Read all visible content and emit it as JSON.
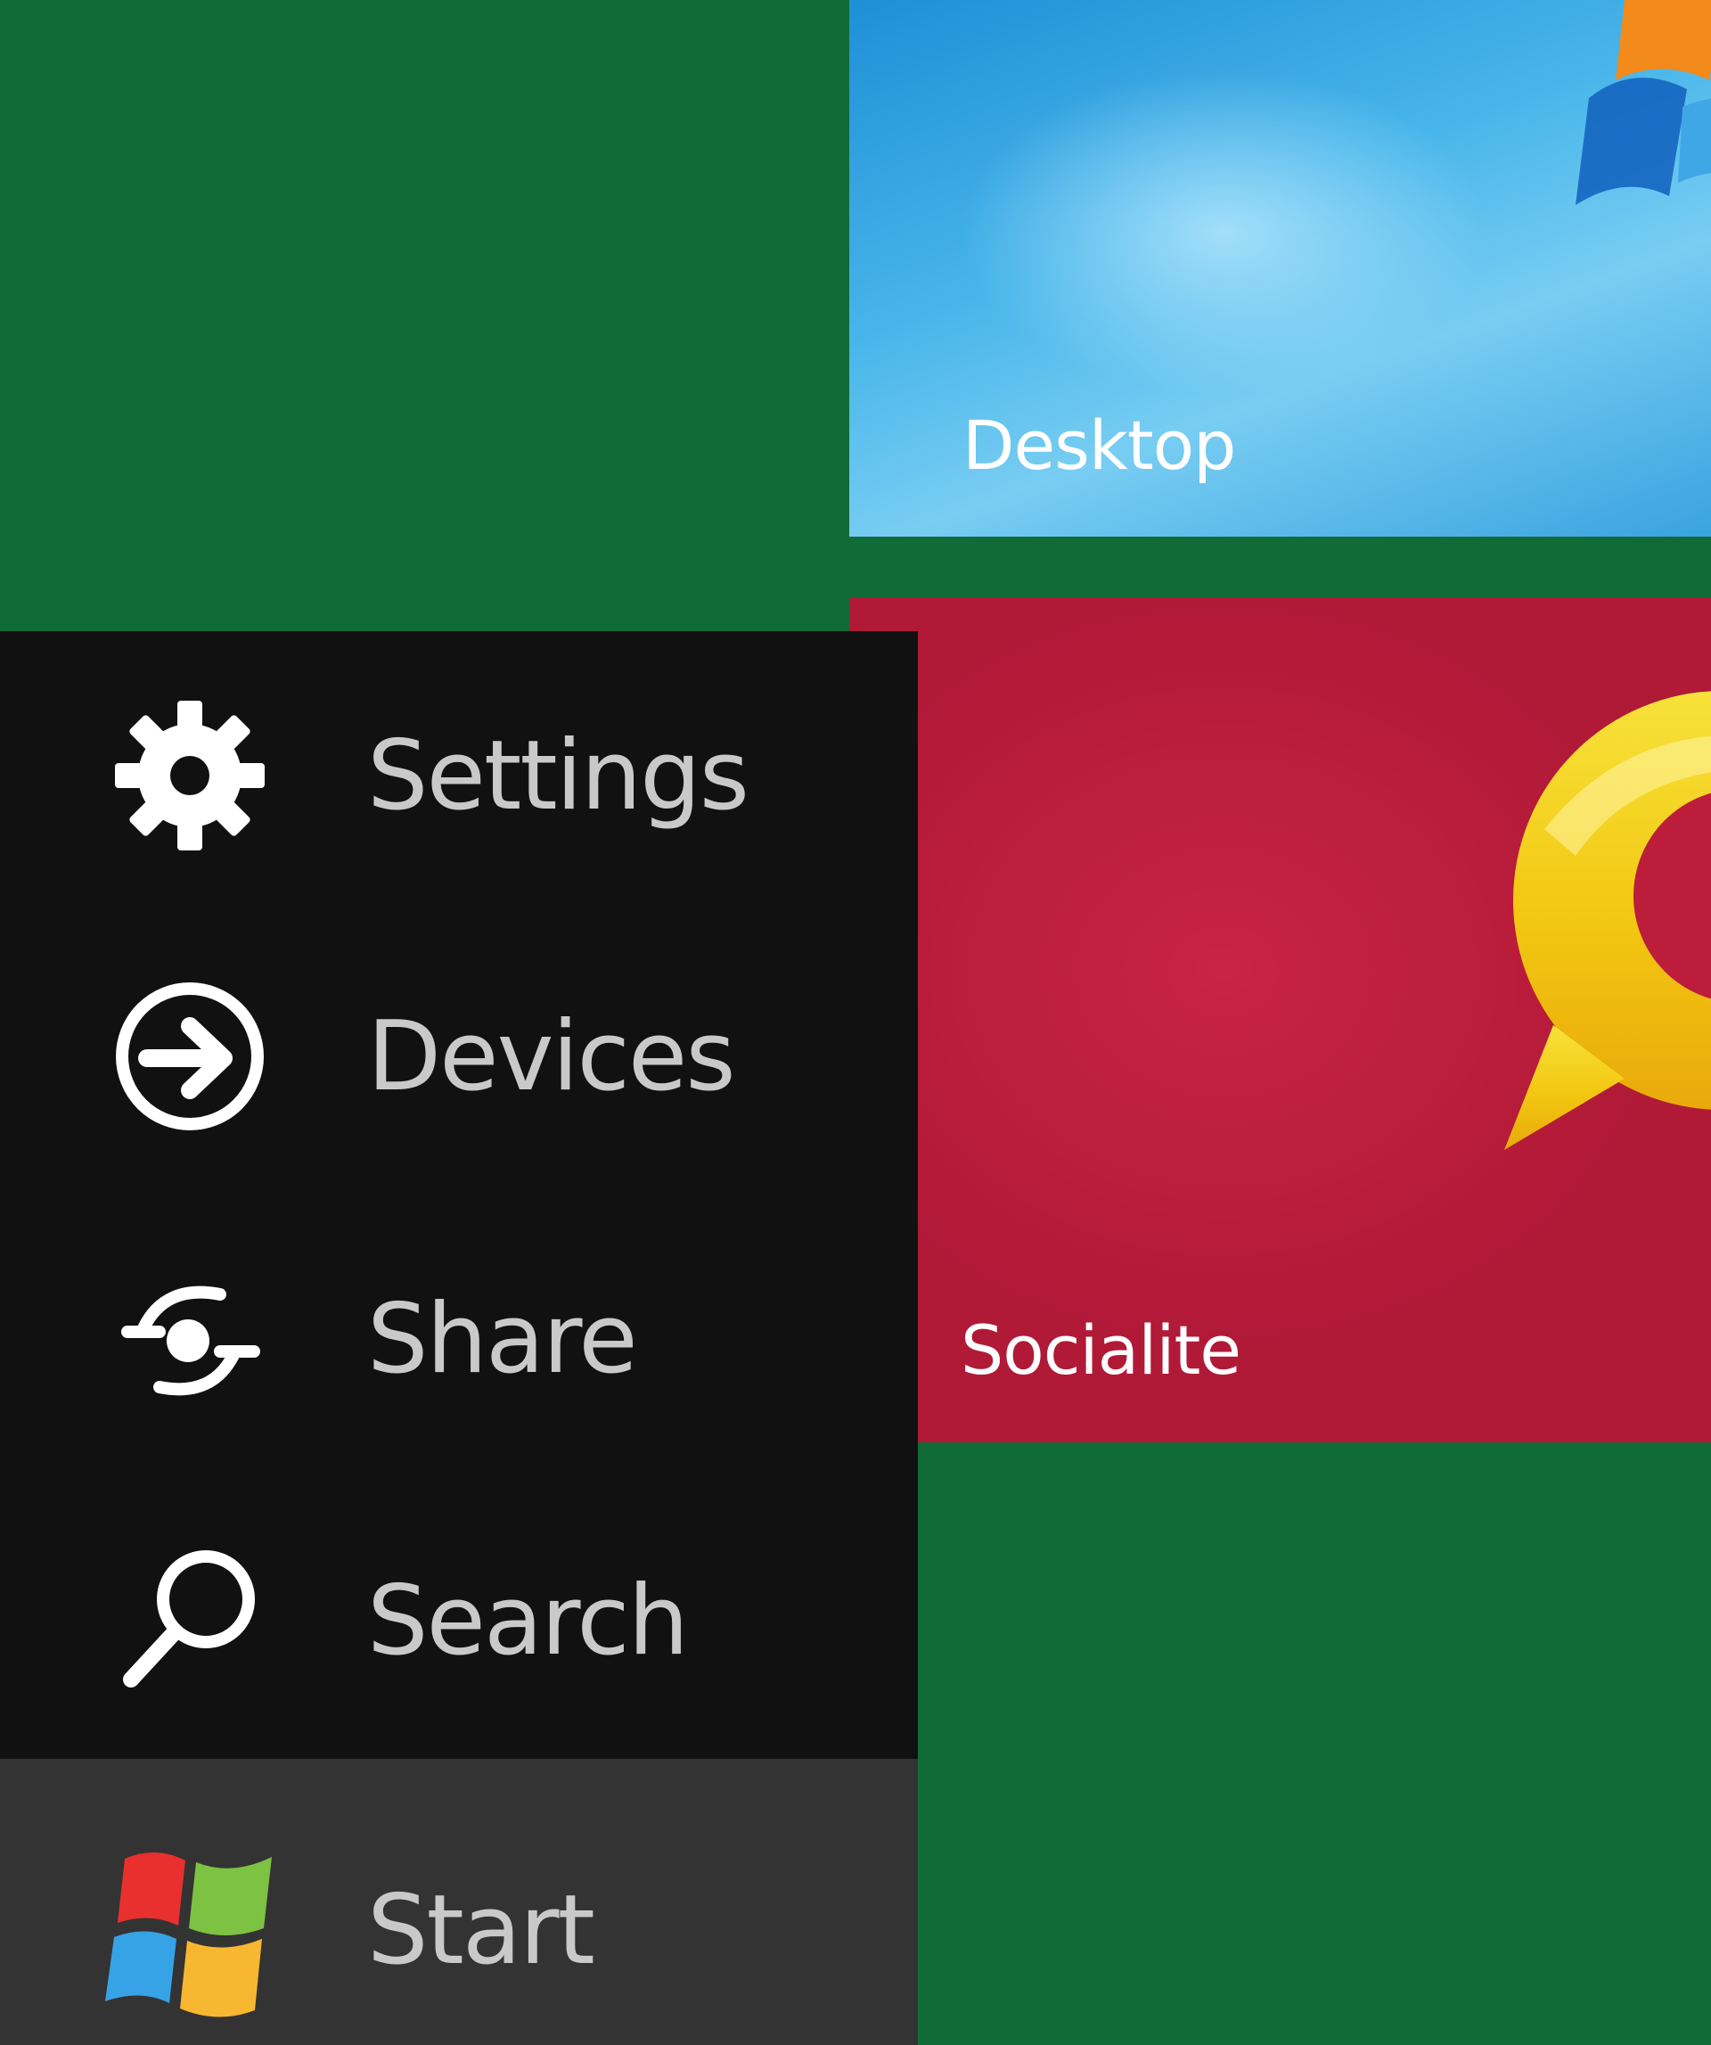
{
  "tiles": {
    "desktop": {
      "label": "Desktop",
      "icon": "windows-flag-wallpaper"
    },
    "socialite": {
      "label": "Socialite",
      "icon": "speech-bubble-icon"
    }
  },
  "charms": {
    "settings": {
      "label": "Settings",
      "icon": "gear-icon"
    },
    "devices": {
      "label": "Devices",
      "icon": "devices-arrow-icon"
    },
    "share": {
      "label": "Share",
      "icon": "share-icon"
    },
    "search": {
      "label": "Search",
      "icon": "search-icon"
    },
    "start": {
      "label": "Start",
      "icon": "windows-logo-icon"
    }
  },
  "colors": {
    "background": "#106b37",
    "charms_bar": "#111111",
    "start_highlight": "#333333",
    "desktop_tile": "#3aa3e0",
    "socialite_tile": "#bb1d3b",
    "socialite_bubble": "#f5d312"
  }
}
